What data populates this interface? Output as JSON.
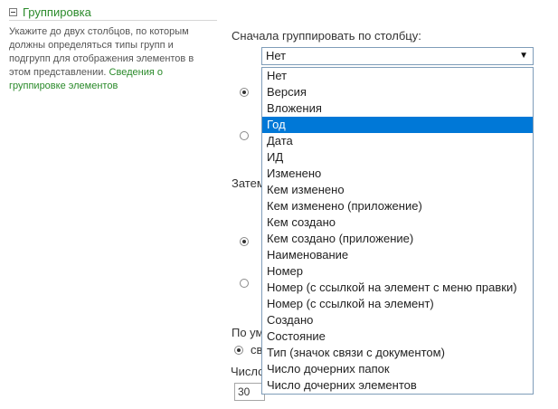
{
  "section": {
    "title": "Группировка",
    "description": "Укажите до двух столбцов, по которым должны определяться типы групп и подгрупп для отображения элементов в этом представлении.",
    "link": "Сведения о группировке элементов"
  },
  "first_group": {
    "label": "Сначала группировать по столбцу:",
    "selected_value": "Нет",
    "options": [
      "Нет",
      "Версия",
      "Вложения",
      "Год",
      "Дата",
      "ИД",
      "Изменено",
      "Кем изменено",
      "Кем изменено (приложение)",
      "Кем создано",
      "Кем создано (приложение)",
      "Наименование",
      "Номер",
      "Номер (с ссылкой на элемент с меню правки)",
      "Номер (с ссылкой на элемент)",
      "Создано",
      "Состояние",
      "Тип (значок связи с документом)",
      "Число дочерних папок",
      "Число дочерних элементов"
    ],
    "highlighted_option": "Год"
  },
  "then_label": "Затем",
  "default_label": "По ум",
  "radio_partial_label": "св",
  "count_label": "Число",
  "count_value": "30"
}
